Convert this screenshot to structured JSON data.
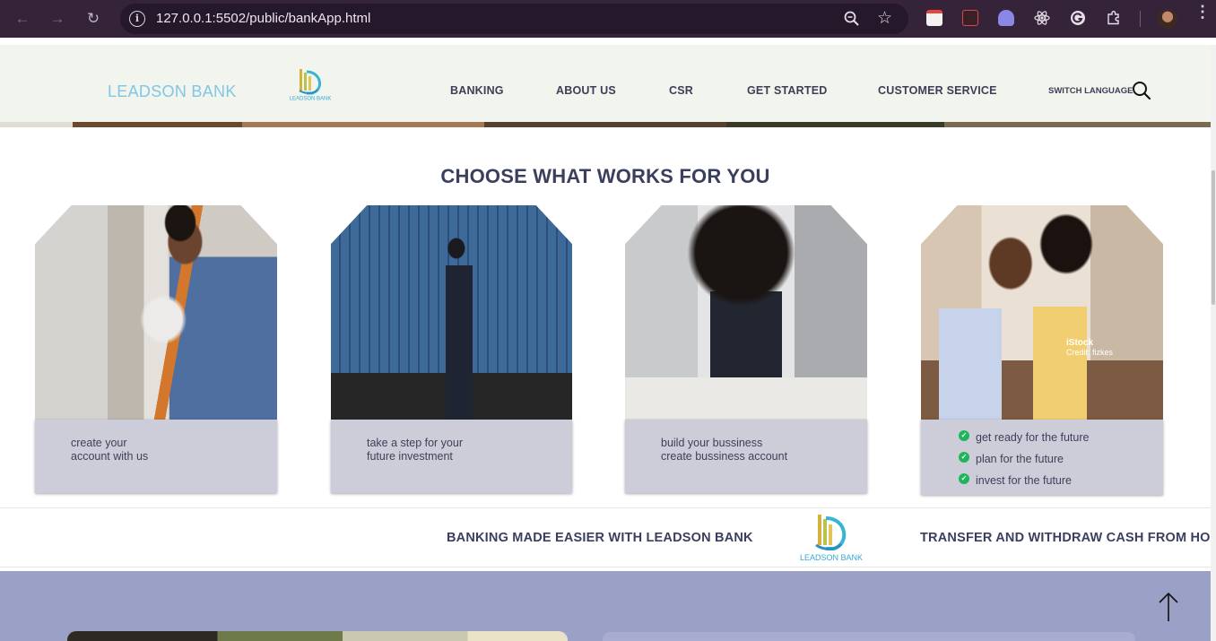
{
  "browser": {
    "url": "127.0.0.1:5502/public/bankApp.html",
    "back_icon": "←",
    "forward_icon": "→",
    "reload_icon": "↻",
    "info_icon": "i",
    "star_icon": "☆",
    "menu_icon": "⋮"
  },
  "header": {
    "brand": "LEADSON BANK",
    "logo_text": "LEADSON BANK",
    "nav": [
      "BANKING",
      "ABOUT US",
      "CSR",
      "GET STARTED",
      "CUSTOMER SERVICE"
    ],
    "switch_language": "SWITCH LANGUAGE"
  },
  "section": {
    "title": "CHOOSE WHAT WORKS FOR YOU",
    "cards": [
      {
        "line1": "create your",
        "line2": "account with us"
      },
      {
        "line1": "take a step for your",
        "line2": "future investment"
      },
      {
        "line1": "build your bussiness",
        "line2": "create bussiness account"
      },
      {
        "checks": [
          "get ready for the future",
          "plan for the future",
          "invest for the future"
        ],
        "watermark": "iStock",
        "watermark_sub": "Credit: fizkes"
      }
    ]
  },
  "marquee": {
    "text1": "BANKING MADE EASIER WITH LEADSON BANK",
    "logo_text": "LEADSON BANK",
    "text2": "TRANSFER AND WITHDRAW CASH FROM HO"
  },
  "colors": {
    "brand": "#7fc7e4",
    "heading": "#3a3f5e",
    "card_body": "#cdcdd9",
    "check": "#1fb55a",
    "lower_bg": "#9aa0c6",
    "chrome_bg": "#35233a"
  }
}
